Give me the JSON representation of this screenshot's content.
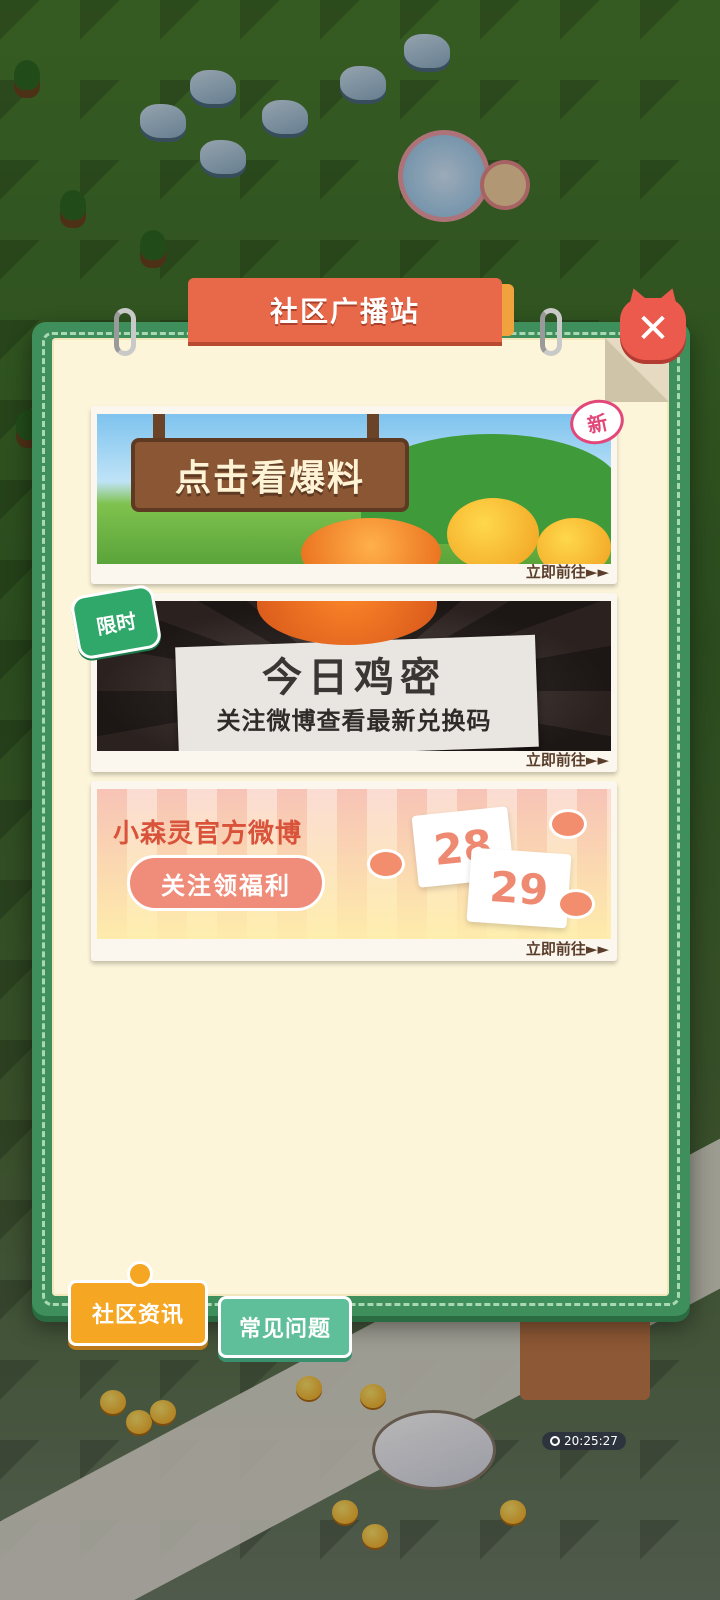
{
  "dialog": {
    "title": "社区广播站",
    "close_label": "✕"
  },
  "cards": [
    {
      "banner_text": "点击看爆料",
      "badge": "新",
      "cta": "立即前往►►"
    },
    {
      "headline": "今日鸡密",
      "subline": "关注微博查看最新兑换码",
      "badge": "限时",
      "cta": "立即前往►►"
    },
    {
      "title": "小森灵官方微博",
      "pill": "关注领福利",
      "cal_a": "28",
      "cal_b": "29",
      "cta": "立即前往►►"
    }
  ],
  "tabs": [
    {
      "label": "社区资讯",
      "active": true
    },
    {
      "label": "常见问题",
      "active": false
    }
  ],
  "clock": "20:25:27",
  "colors": {
    "board_green": "#3f8f5c",
    "paper": "#fdf5d9",
    "title_orange": "#e8694a",
    "close_red": "#ec5a4d",
    "tab_active": "#f5a623",
    "tab_idle": "#5fbf9a"
  }
}
